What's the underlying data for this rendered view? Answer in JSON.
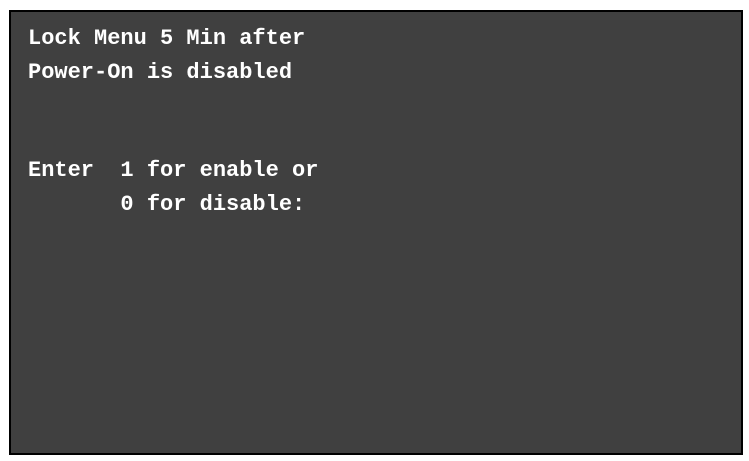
{
  "screen": {
    "status_line_1": "Lock Menu 5 Min after",
    "status_line_2": "Power-On is disabled",
    "prompt_line_1": "Enter  1 for enable or",
    "prompt_line_2": "       0 for disable:"
  },
  "colors": {
    "background": "#404040",
    "text": "#ffffff",
    "border": "#000000"
  }
}
